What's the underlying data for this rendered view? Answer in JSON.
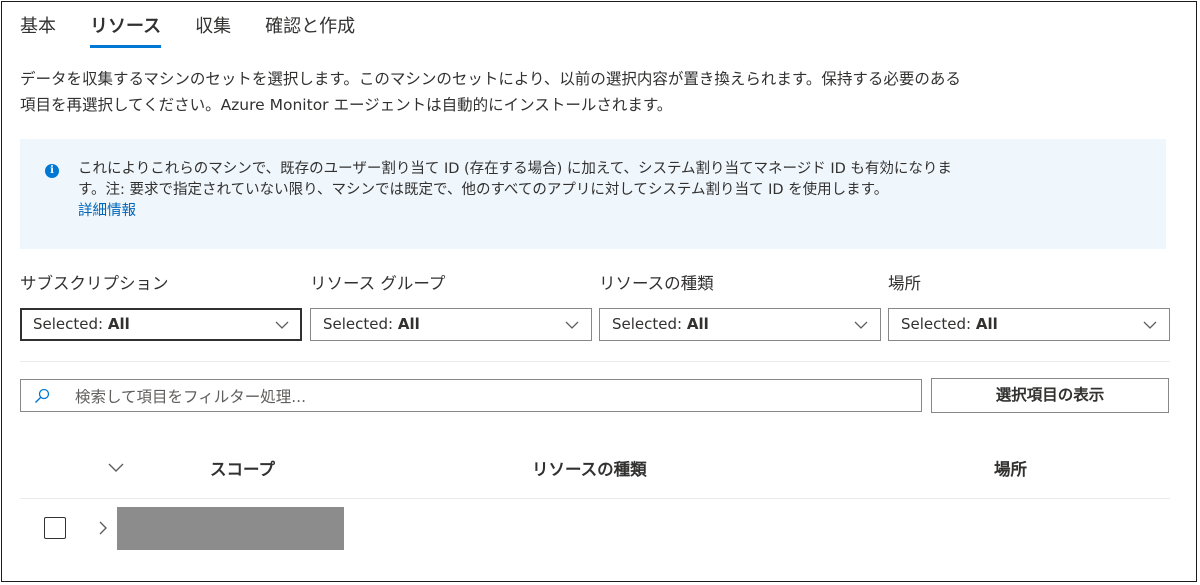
{
  "tabs": [
    {
      "label": "基本",
      "active": false
    },
    {
      "label": "リソース",
      "active": true
    },
    {
      "label": "収集",
      "active": false
    },
    {
      "label": "確認と作成",
      "active": false
    }
  ],
  "description": {
    "line1": "データを収集するマシンのセットを選択します。このマシンのセットにより、以前の選択内容が置き換えられます。保持する必要のある",
    "line2": "項目を再選択してください。Azure Monitor エージェントは自動的にインストールされます。"
  },
  "info": {
    "icon": "info-icon",
    "text_line1": "これによりこれらのマシンで、既存のユーザー割り当て ID (存在する場合) に加えて、システム割り当てマネージド ID も有効になりま",
    "text_line2": "す。注: 要求で指定されていない限り、マシンでは既定で、他のすべてのアプリに対してシステム割り当て ID を使用します。",
    "link": "詳細情報"
  },
  "filters": [
    {
      "label": "サブスクリプション",
      "prefix": "Selected: ",
      "value": "All"
    },
    {
      "label": "リソース グループ",
      "prefix": "Selected: ",
      "value": "All"
    },
    {
      "label": "リソースの種類",
      "prefix": "Selected: ",
      "value": "All"
    },
    {
      "label": "場所",
      "prefix": "Selected: ",
      "value": "All"
    }
  ],
  "search": {
    "placeholder": "検索して項目をフィルター処理...",
    "value": ""
  },
  "show_selected_button": "選択項目の表示",
  "table": {
    "columns": [
      "スコープ",
      "リソースの種類",
      "場所"
    ],
    "rows": [
      {
        "scope_redacted": true,
        "resource_type": "",
        "location": ""
      }
    ]
  },
  "colors": {
    "accent": "#0078d4",
    "info_background": "#eff6fc",
    "link": "#0066b8",
    "redaction": "#8c8c8c"
  }
}
